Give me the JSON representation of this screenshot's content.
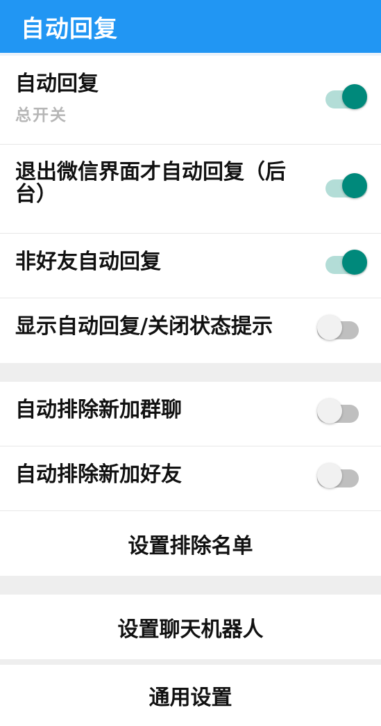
{
  "app": {
    "title": "自动回复"
  },
  "settings": {
    "section1": {
      "items": [
        {
          "label": "自动回复",
          "subtitle": "总开关",
          "enabled": true
        },
        {
          "label": "退出微信界面才自动回复（后台）",
          "enabled": true
        },
        {
          "label": "非好友自动回复",
          "enabled": true
        },
        {
          "label": "显示自动回复/关闭状态提示",
          "enabled": false
        }
      ]
    },
    "section2": {
      "items": [
        {
          "label": "自动排除新加群聊",
          "enabled": false
        },
        {
          "label": "自动排除新加好友",
          "enabled": false
        }
      ],
      "action": "设置排除名单"
    },
    "section3": {
      "action": "设置聊天机器人"
    },
    "section4": {
      "action": "通用设置"
    }
  },
  "colors": {
    "app_bar": "#2196f3",
    "switch_on_thumb": "#00897b",
    "switch_on_track": "#b3ddd7",
    "switch_off_thumb": "#f1f1f1",
    "switch_off_track": "#bfbfbf",
    "section_gap": "#eeeeee"
  },
  "icons": {
    "toggle_on": "toggle-switch",
    "toggle_off": "toggle-switch"
  }
}
